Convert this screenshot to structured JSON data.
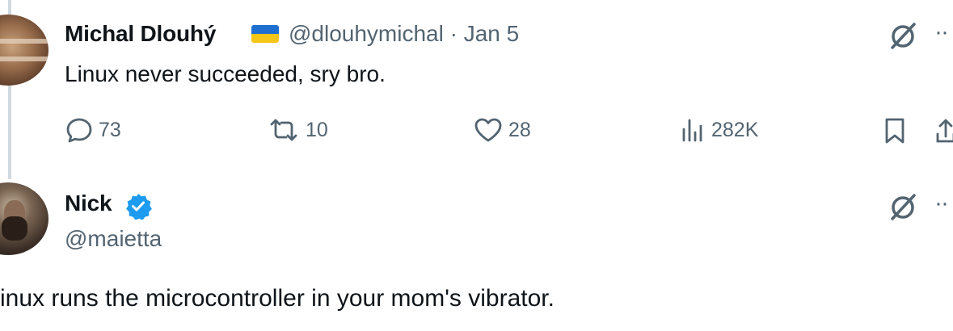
{
  "tweet1": {
    "display_name": "Michal Dlouhý",
    "flag_emoji": "ukraine-flag",
    "handle": "@dlouhymichal",
    "separator": "·",
    "date": "Jan 5",
    "text": "Linux never succeeded, sry bro.",
    "stats": {
      "replies": "73",
      "reposts": "10",
      "likes": "28",
      "views": "282K"
    }
  },
  "tweet2": {
    "display_name": "Nick",
    "verified": true,
    "handle": "@maietta",
    "text": "inux runs the microcontroller in your mom's vibrator."
  },
  "colors": {
    "text": "#0f1419",
    "secondary": "#536471",
    "verified": "#1d9bf0",
    "thread_line": "#cfd9de"
  }
}
